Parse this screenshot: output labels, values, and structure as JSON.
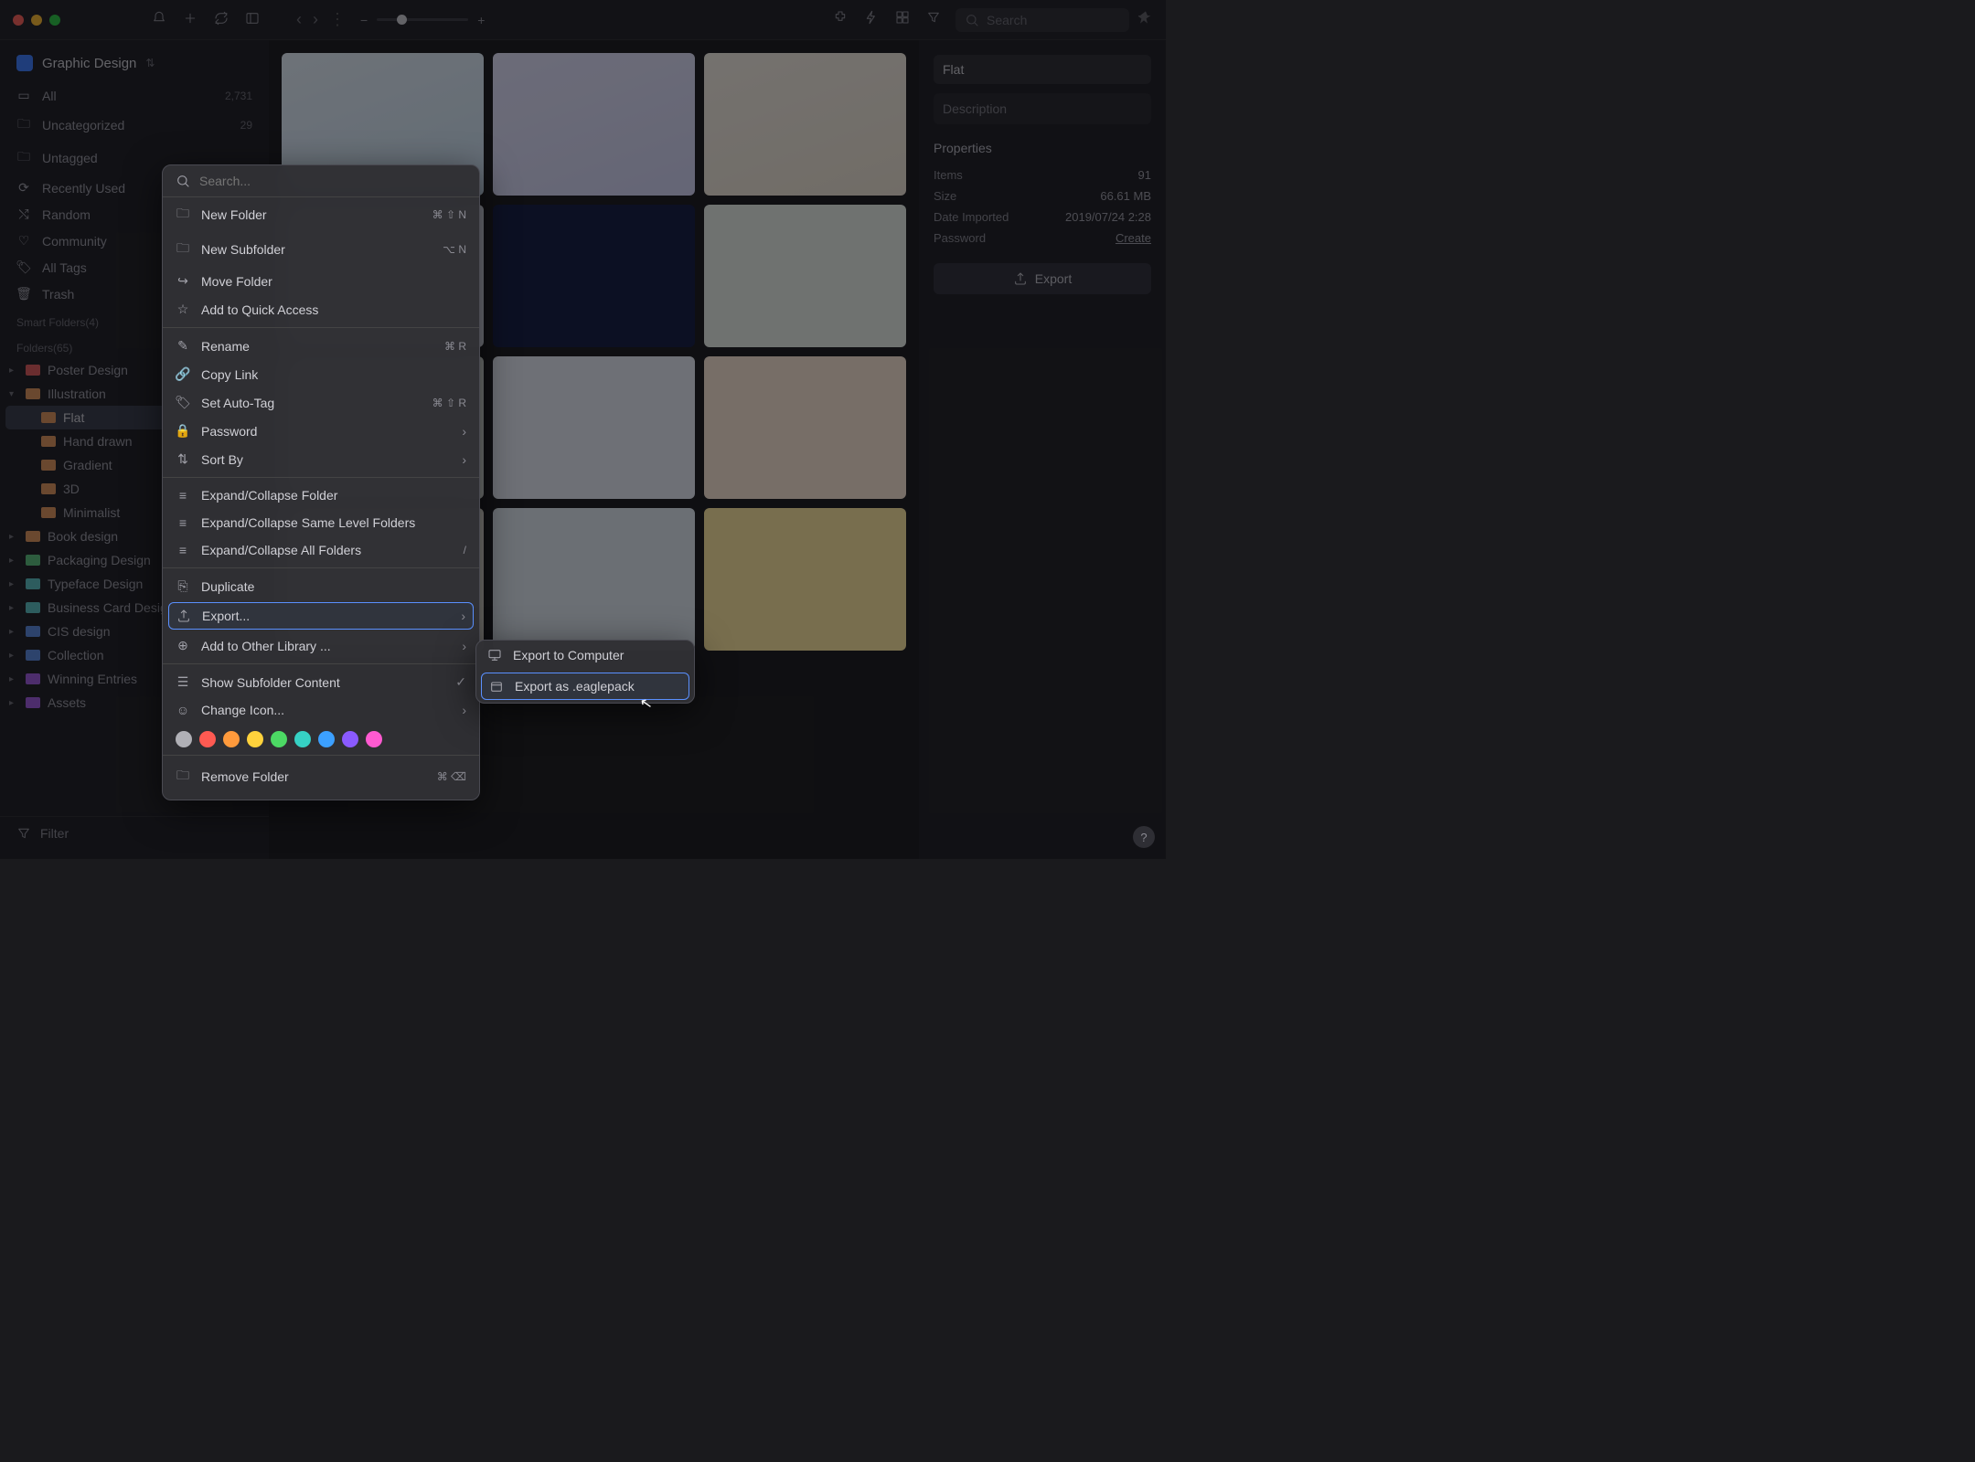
{
  "titlebar": {
    "search_placeholder": "Search"
  },
  "library": {
    "name": "Graphic Design"
  },
  "sidebar": {
    "nav": [
      {
        "label": "All",
        "count": "2,731"
      },
      {
        "label": "Uncategorized",
        "count": "29"
      },
      {
        "label": "Untagged",
        "count": ""
      },
      {
        "label": "Recently Used",
        "count": ""
      },
      {
        "label": "Random",
        "count": ""
      },
      {
        "label": "Community",
        "count": ""
      },
      {
        "label": "All Tags",
        "count": ""
      },
      {
        "label": "Trash",
        "count": ""
      }
    ],
    "smart_label": "Smart Folders(4)",
    "folders_label": "Folders(65)",
    "folders": [
      {
        "label": "Poster Design",
        "color": "fi-red"
      },
      {
        "label": "Illustration",
        "color": "fi-orn",
        "open": true
      },
      {
        "label": "Flat",
        "color": "fi-orn",
        "sub": true,
        "sel": true
      },
      {
        "label": "Hand drawn",
        "color": "fi-orn",
        "sub": true
      },
      {
        "label": "Gradient",
        "color": "fi-orn",
        "sub": true
      },
      {
        "label": "3D",
        "color": "fi-orn",
        "sub": true
      },
      {
        "label": "Minimalist",
        "color": "fi-orn",
        "sub": true
      },
      {
        "label": "Book design",
        "color": "fi-orn"
      },
      {
        "label": "Packaging Design",
        "color": "fi-grn"
      },
      {
        "label": "Typeface Design",
        "color": "fi-teal"
      },
      {
        "label": "Business Card Design",
        "color": "fi-teal"
      },
      {
        "label": "CIS design",
        "color": "fi-blue"
      },
      {
        "label": "Collection",
        "color": "fi-blue"
      },
      {
        "label": "Winning Entries",
        "color": "fi-pur"
      },
      {
        "label": "Assets",
        "color": "fi-pur"
      }
    ],
    "filter_label": "Filter"
  },
  "props": {
    "title_value": "Flat",
    "desc_placeholder": "Description",
    "heading": "Properties",
    "rows": [
      {
        "k": "Items",
        "v": "91"
      },
      {
        "k": "Size",
        "v": "66.61 MB"
      },
      {
        "k": "Date Imported",
        "v": "2019/07/24 2:28"
      },
      {
        "k": "Password",
        "v": "Create"
      }
    ],
    "export_label": "Export"
  },
  "ctx": {
    "search_placeholder": "Search...",
    "items1": [
      {
        "label": "New Folder",
        "sc": "⌘ ⇧ N"
      },
      {
        "label": "New Subfolder",
        "sc": "⌥ N"
      },
      {
        "label": "Move Folder",
        "sc": ""
      },
      {
        "label": "Add to Quick Access",
        "sc": ""
      }
    ],
    "items2": [
      {
        "label": "Rename",
        "sc": "⌘ R"
      },
      {
        "label": "Copy Link",
        "sc": ""
      },
      {
        "label": "Set Auto-Tag",
        "sc": "⌘ ⇧ R"
      },
      {
        "label": "Password",
        "sc": "›"
      },
      {
        "label": "Sort By",
        "sc": "›"
      }
    ],
    "items3": [
      {
        "label": "Expand/Collapse Folder"
      },
      {
        "label": "Expand/Collapse Same Level Folders"
      },
      {
        "label": "Expand/Collapse All Folders",
        "sc": "/"
      }
    ],
    "duplicate": "Duplicate",
    "export": "Export...",
    "add_other": "Add to Other Library ...",
    "show_sub": "Show Subfolder Content",
    "change_icon": "Change Icon...",
    "remove": "Remove Folder",
    "remove_sc": "⌘ ⌫",
    "colors": [
      "#b0b0b6",
      "#ff5a52",
      "#ff9a3c",
      "#ffd23c",
      "#4cd964",
      "#36d1c4",
      "#3ca0ff",
      "#8a5aff",
      "#ff5ad1"
    ]
  },
  "submenu": {
    "opt1": "Export to Computer",
    "opt2": "Export as .eaglepack"
  }
}
